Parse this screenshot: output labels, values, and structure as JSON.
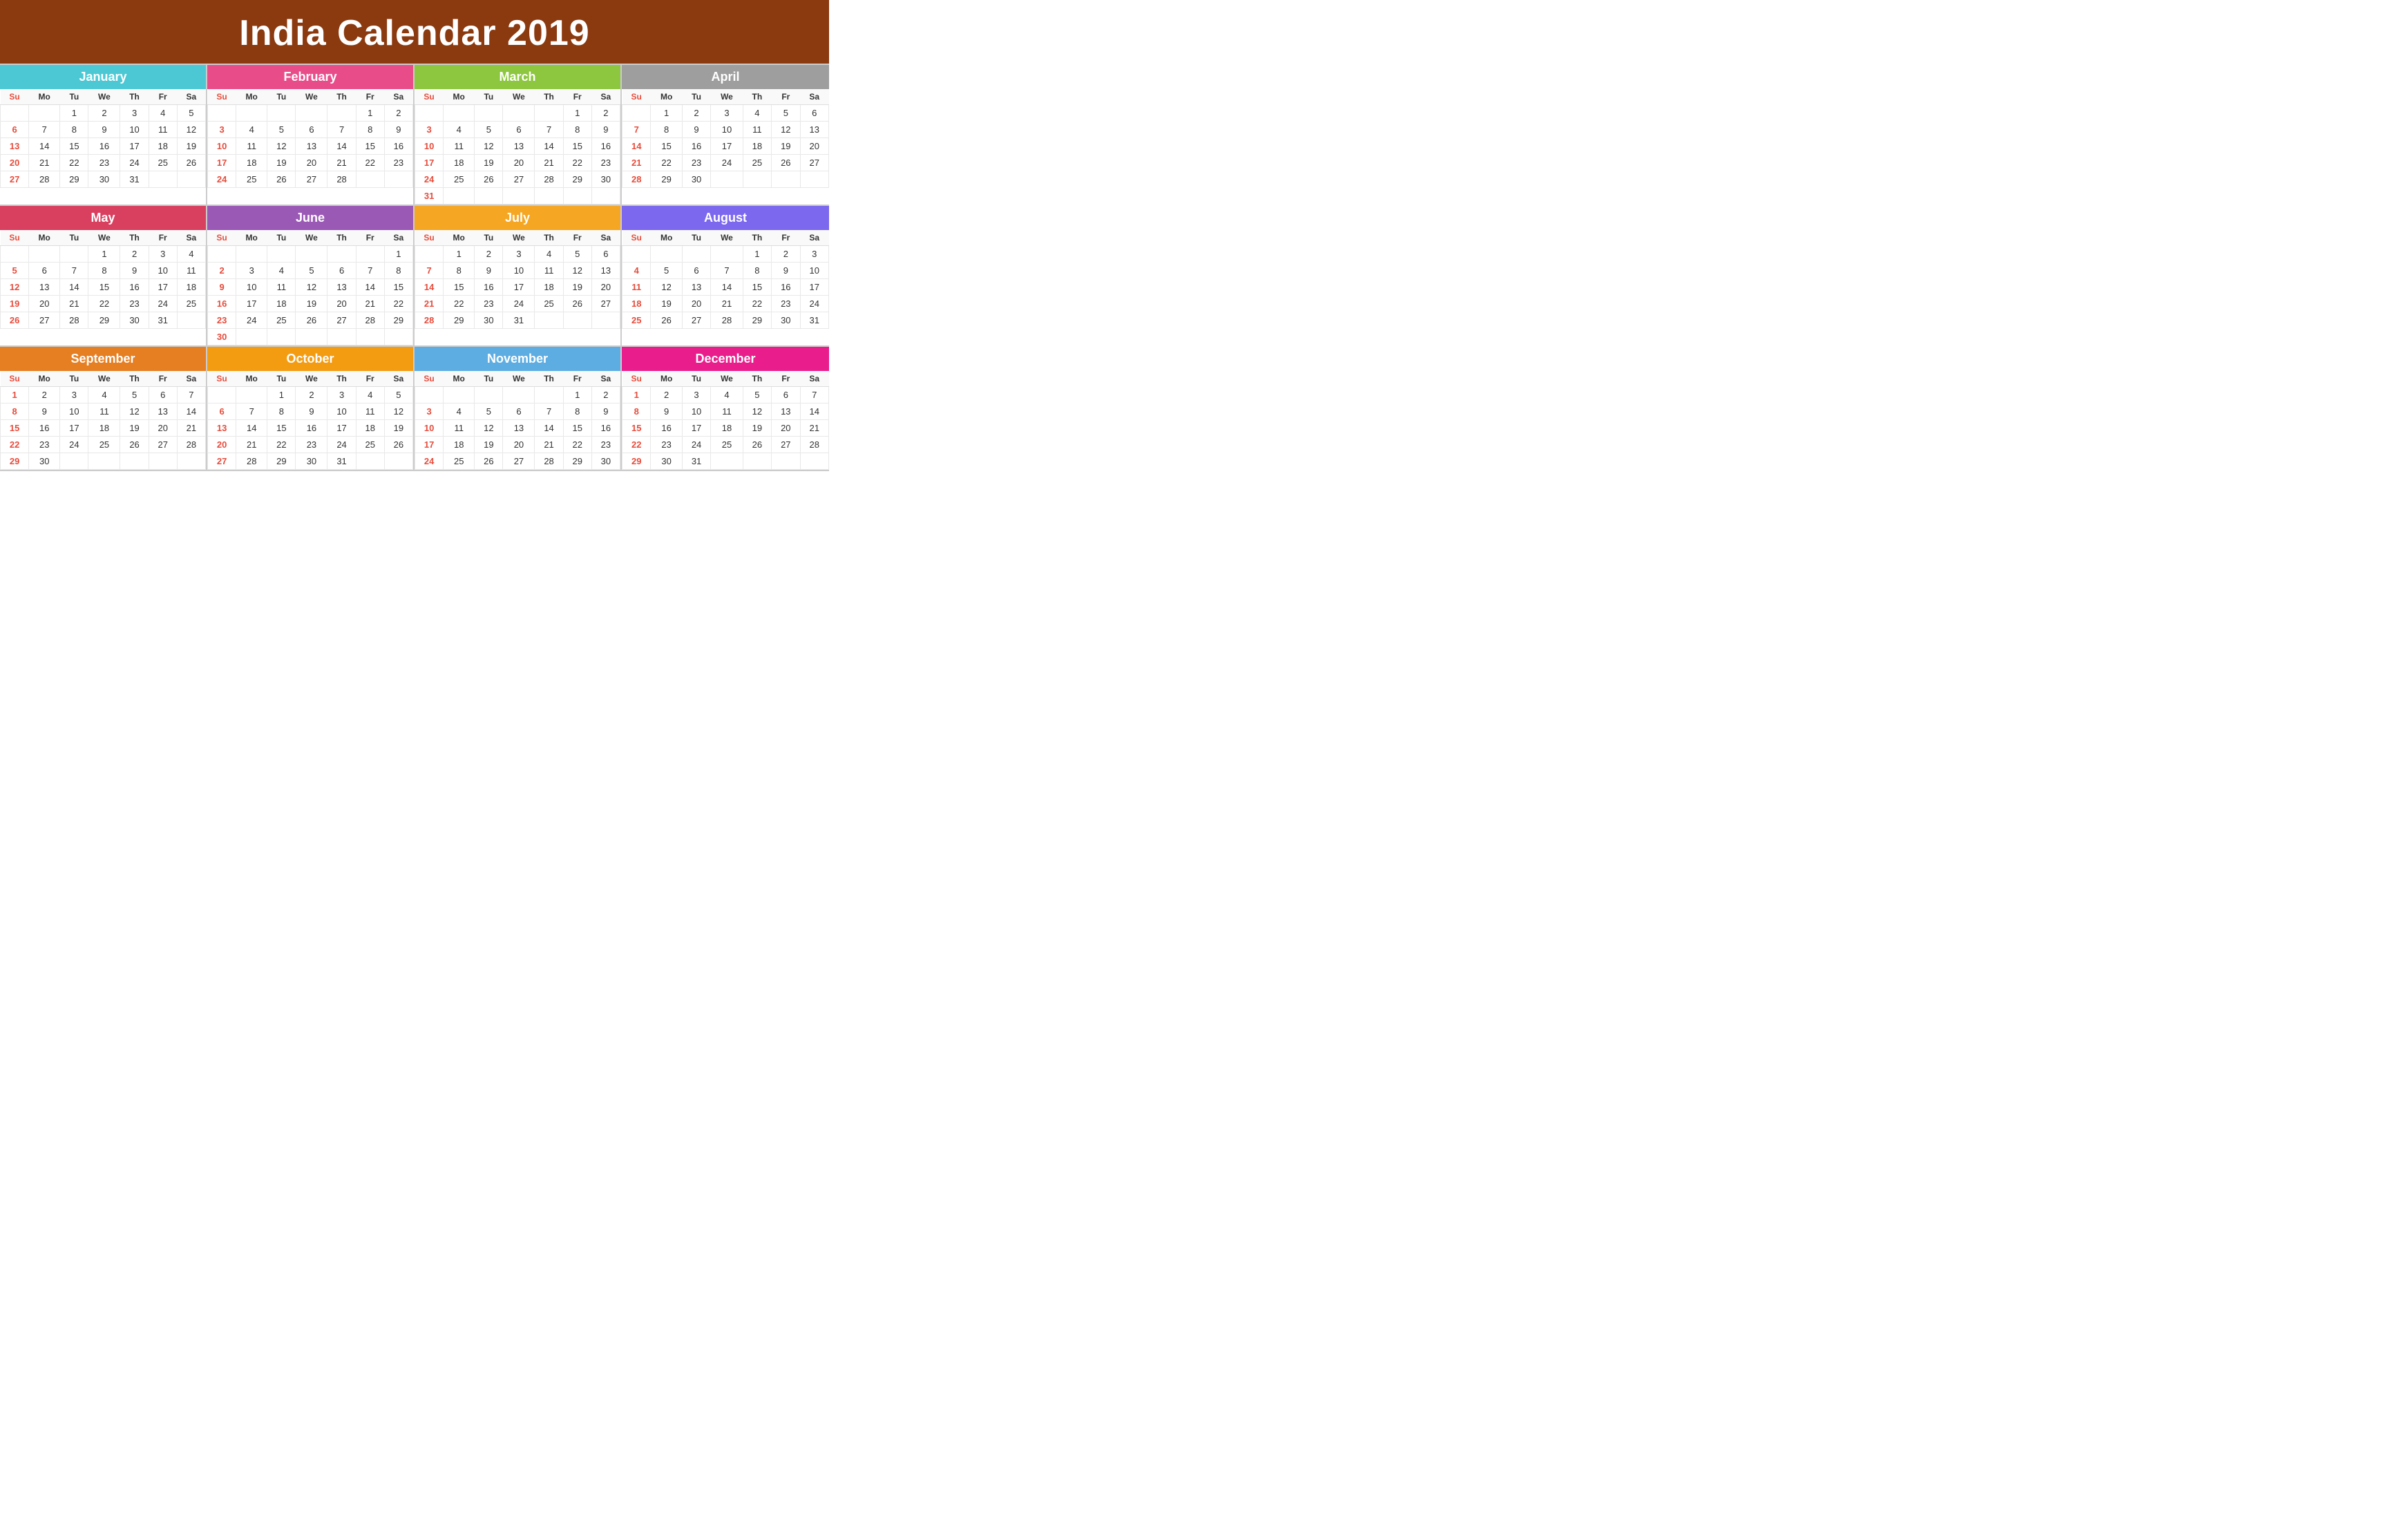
{
  "header": {
    "title": "India Calendar 2019",
    "bg_color": "#8B3A10"
  },
  "months": [
    {
      "name": "January",
      "color_class": "month-january",
      "days_header": [
        "Su",
        "Mo",
        "Tu",
        "We",
        "Th",
        "Fr",
        "Sa"
      ],
      "weeks": [
        [
          "",
          "",
          "1",
          "2",
          "3",
          "4",
          "5"
        ],
        [
          "6",
          "7",
          "8",
          "9",
          "10",
          "11",
          "12"
        ],
        [
          "13",
          "14",
          "15",
          "16",
          "17",
          "18",
          "19"
        ],
        [
          "20",
          "21",
          "22",
          "23",
          "24",
          "25",
          "26"
        ],
        [
          "27",
          "28",
          "29",
          "30",
          "31",
          "",
          ""
        ]
      ]
    },
    {
      "name": "February",
      "color_class": "month-february",
      "days_header": [
        "Su",
        "Mo",
        "Tu",
        "We",
        "Th",
        "Fr",
        "Sa"
      ],
      "weeks": [
        [
          "",
          "",
          "",
          "",
          "",
          "1",
          "2"
        ],
        [
          "3",
          "4",
          "5",
          "6",
          "7",
          "8",
          "9"
        ],
        [
          "10",
          "11",
          "12",
          "13",
          "14",
          "15",
          "16"
        ],
        [
          "17",
          "18",
          "19",
          "20",
          "21",
          "22",
          "23"
        ],
        [
          "24",
          "25",
          "26",
          "27",
          "28",
          "",
          ""
        ]
      ]
    },
    {
      "name": "March",
      "color_class": "month-march",
      "days_header": [
        "Su",
        "Mo",
        "Tu",
        "We",
        "Th",
        "Fr",
        "Sa"
      ],
      "weeks": [
        [
          "",
          "",
          "",
          "",
          "",
          "1",
          "2"
        ],
        [
          "3",
          "4",
          "5",
          "6",
          "7",
          "8",
          "9"
        ],
        [
          "10",
          "11",
          "12",
          "13",
          "14",
          "15",
          "16"
        ],
        [
          "17",
          "18",
          "19",
          "20",
          "21",
          "22",
          "23"
        ],
        [
          "24",
          "25",
          "26",
          "27",
          "28",
          "29",
          "30"
        ],
        [
          "31",
          "",
          "",
          "",
          "",
          "",
          ""
        ]
      ]
    },
    {
      "name": "April",
      "color_class": "month-april",
      "days_header": [
        "Su",
        "Mo",
        "Tu",
        "We",
        "Th",
        "Fr",
        "Sa"
      ],
      "weeks": [
        [
          "",
          "1",
          "2",
          "3",
          "4",
          "5",
          "6"
        ],
        [
          "7",
          "8",
          "9",
          "10",
          "11",
          "12",
          "13"
        ],
        [
          "14",
          "15",
          "16",
          "17",
          "18",
          "19",
          "20"
        ],
        [
          "21",
          "22",
          "23",
          "24",
          "25",
          "26",
          "27"
        ],
        [
          "28",
          "29",
          "30",
          "",
          "",
          "",
          ""
        ]
      ]
    },
    {
      "name": "May",
      "color_class": "month-may",
      "days_header": [
        "Su",
        "Mo",
        "Tu",
        "We",
        "Th",
        "Fr",
        "Sa"
      ],
      "weeks": [
        [
          "",
          "",
          "",
          "1",
          "2",
          "3",
          "4"
        ],
        [
          "5",
          "6",
          "7",
          "8",
          "9",
          "10",
          "11"
        ],
        [
          "12",
          "13",
          "14",
          "15",
          "16",
          "17",
          "18"
        ],
        [
          "19",
          "20",
          "21",
          "22",
          "23",
          "24",
          "25"
        ],
        [
          "26",
          "27",
          "28",
          "29",
          "30",
          "31",
          ""
        ]
      ]
    },
    {
      "name": "June",
      "color_class": "month-june",
      "days_header": [
        "Su",
        "Mo",
        "Tu",
        "We",
        "Th",
        "Fr",
        "Sa"
      ],
      "weeks": [
        [
          "",
          "",
          "",
          "",
          "",
          "",
          "1"
        ],
        [
          "2",
          "3",
          "4",
          "5",
          "6",
          "7",
          "8"
        ],
        [
          "9",
          "10",
          "11",
          "12",
          "13",
          "14",
          "15"
        ],
        [
          "16",
          "17",
          "18",
          "19",
          "20",
          "21",
          "22"
        ],
        [
          "23",
          "24",
          "25",
          "26",
          "27",
          "28",
          "29"
        ],
        [
          "30",
          "",
          "",
          "",
          "",
          "",
          ""
        ]
      ]
    },
    {
      "name": "July",
      "color_class": "month-july",
      "days_header": [
        "Su",
        "Mo",
        "Tu",
        "We",
        "Th",
        "Fr",
        "Sa"
      ],
      "weeks": [
        [
          "",
          "1",
          "2",
          "3",
          "4",
          "5",
          "6"
        ],
        [
          "7",
          "8",
          "9",
          "10",
          "11",
          "12",
          "13"
        ],
        [
          "14",
          "15",
          "16",
          "17",
          "18",
          "19",
          "20"
        ],
        [
          "21",
          "22",
          "23",
          "24",
          "25",
          "26",
          "27"
        ],
        [
          "28",
          "29",
          "30",
          "31",
          "",
          "",
          ""
        ]
      ]
    },
    {
      "name": "August",
      "color_class": "month-august",
      "days_header": [
        "Su",
        "Mo",
        "Tu",
        "We",
        "Th",
        "Fr",
        "Sa"
      ],
      "weeks": [
        [
          "",
          "",
          "",
          "",
          "1",
          "2",
          "3"
        ],
        [
          "4",
          "5",
          "6",
          "7",
          "8",
          "9",
          "10"
        ],
        [
          "11",
          "12",
          "13",
          "14",
          "15",
          "16",
          "17"
        ],
        [
          "18",
          "19",
          "20",
          "21",
          "22",
          "23",
          "24"
        ],
        [
          "25",
          "26",
          "27",
          "28",
          "29",
          "30",
          "31"
        ]
      ]
    },
    {
      "name": "September",
      "color_class": "month-september",
      "days_header": [
        "Su",
        "Mo",
        "Tu",
        "We",
        "Th",
        "Fr",
        "Sa"
      ],
      "weeks": [
        [
          "1",
          "2",
          "3",
          "4",
          "5",
          "6",
          "7"
        ],
        [
          "8",
          "9",
          "10",
          "11",
          "12",
          "13",
          "14"
        ],
        [
          "15",
          "16",
          "17",
          "18",
          "19",
          "20",
          "21"
        ],
        [
          "22",
          "23",
          "24",
          "25",
          "26",
          "27",
          "28"
        ],
        [
          "29",
          "30",
          "",
          "",
          "",
          "",
          ""
        ]
      ]
    },
    {
      "name": "October",
      "color_class": "month-october",
      "days_header": [
        "Su",
        "Mo",
        "Tu",
        "We",
        "Th",
        "Fr",
        "Sa"
      ],
      "weeks": [
        [
          "",
          "",
          "1",
          "2",
          "3",
          "4",
          "5"
        ],
        [
          "6",
          "7",
          "8",
          "9",
          "10",
          "11",
          "12"
        ],
        [
          "13",
          "14",
          "15",
          "16",
          "17",
          "18",
          "19"
        ],
        [
          "20",
          "21",
          "22",
          "23",
          "24",
          "25",
          "26"
        ],
        [
          "27",
          "28",
          "29",
          "30",
          "31",
          "",
          ""
        ]
      ]
    },
    {
      "name": "November",
      "color_class": "month-november",
      "days_header": [
        "Su",
        "Mo",
        "Tu",
        "We",
        "Th",
        "Fr",
        "Sa"
      ],
      "weeks": [
        [
          "",
          "",
          "",
          "",
          "",
          "1",
          "2"
        ],
        [
          "3",
          "4",
          "5",
          "6",
          "7",
          "8",
          "9"
        ],
        [
          "10",
          "11",
          "12",
          "13",
          "14",
          "15",
          "16"
        ],
        [
          "17",
          "18",
          "19",
          "20",
          "21",
          "22",
          "23"
        ],
        [
          "24",
          "25",
          "26",
          "27",
          "28",
          "29",
          "30"
        ]
      ]
    },
    {
      "name": "December",
      "color_class": "month-december",
      "days_header": [
        "Su",
        "Mo",
        "Tu",
        "We",
        "Th",
        "Fr",
        "Sa"
      ],
      "weeks": [
        [
          "1",
          "2",
          "3",
          "4",
          "5",
          "6",
          "7"
        ],
        [
          "8",
          "9",
          "10",
          "11",
          "12",
          "13",
          "14"
        ],
        [
          "15",
          "16",
          "17",
          "18",
          "19",
          "20",
          "21"
        ],
        [
          "22",
          "23",
          "24",
          "25",
          "26",
          "27",
          "28"
        ],
        [
          "29",
          "30",
          "31",
          "",
          "",
          "",
          ""
        ]
      ]
    }
  ]
}
